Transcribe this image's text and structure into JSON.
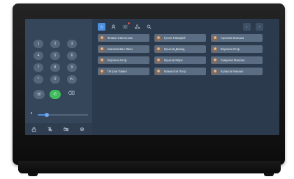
{
  "keypad": {
    "keys": [
      "1",
      "2",
      "3",
      "4",
      "5",
      "6",
      "7",
      "8",
      "9",
      "*",
      "0",
      "#+"
    ],
    "call_icons": {
      "left": "phone-transfer-icon",
      "center": "phone-icon",
      "right": "backspace-icon"
    }
  },
  "volume": {
    "icon": "speaker-icon",
    "level": 0.18
  },
  "bottom_bar": [
    "lock-icon",
    "mic-off-icon",
    "camera-off-icon",
    "settings-icon"
  ],
  "toolbar": {
    "tabs": [
      "star-icon",
      "person-icon",
      "missed-calls-icon",
      "group-icon",
      "search-icon"
    ],
    "nav": [
      "‹",
      "›"
    ]
  },
  "contacts": [
    "Фомин Святослав",
    "Гусев Тимофей",
    "Архипов Максим",
    "Шипилкович Иван",
    "Крылов Демид",
    "Воронин Егор",
    "Воронин Егор",
    "Крылов Марк",
    "Смирнов Максим",
    "Петров Павел",
    "Мамонтов Петр",
    "Кулаков Михаил"
  ]
}
